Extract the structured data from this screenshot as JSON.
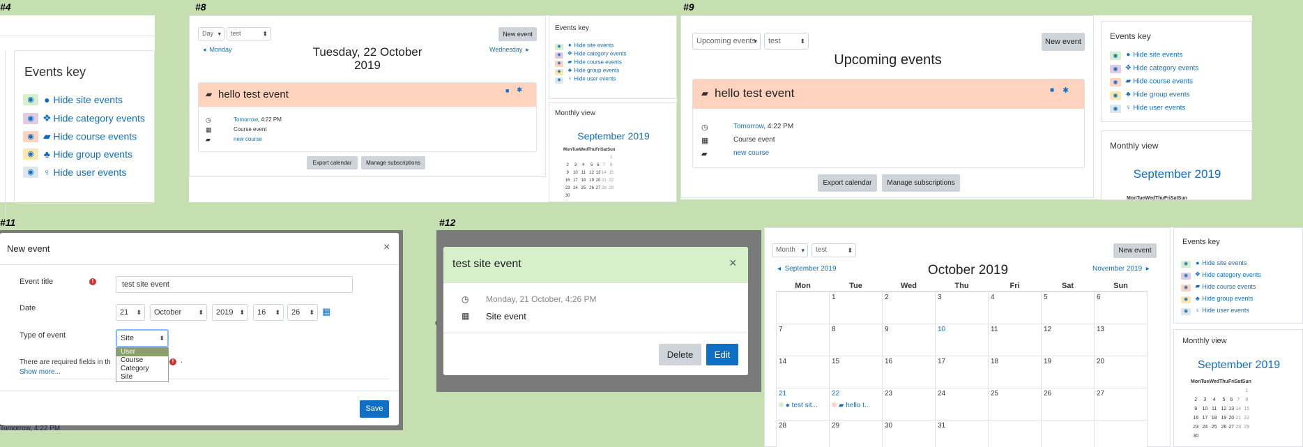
{
  "labels": {
    "p4": "#4",
    "p8": "#8",
    "p9": "#9",
    "p11": "#11",
    "p12": "#12"
  },
  "colors": {
    "site": "#d7f0cc",
    "category": "#e0cbe0",
    "course": "#ffd3bd",
    "group": "#fee7ae",
    "user": "#dce7ec",
    "primary": "#0f6fc5",
    "header": "#ffd3bd"
  },
  "events_key": {
    "title": "Events key",
    "items": [
      {
        "label": "Hide site events",
        "icon": "globe-icon",
        "glyph": "●"
      },
      {
        "label": "Hide category events",
        "icon": "cubes-icon",
        "glyph": "❖"
      },
      {
        "label": "Hide course events",
        "icon": "graduation-cap-icon",
        "glyph": "▰"
      },
      {
        "label": "Hide group events",
        "icon": "users-icon",
        "glyph": "♣"
      },
      {
        "label": "Hide user events",
        "icon": "user-icon",
        "glyph": "♀"
      }
    ]
  },
  "day_view": {
    "view_select": "Day",
    "course_select": "test",
    "new_event": "New event",
    "prev": "Monday",
    "next": "Wednesday",
    "title_line1": "Tuesday, 22 October",
    "title_line2": "2019",
    "event_name": "hello test event",
    "time_link": "Tomorrow",
    "time_rest": ", 4:22 PM",
    "event_type": "Course event",
    "course_link": "new course",
    "export": "Export calendar",
    "manage": "Manage subscriptions"
  },
  "upcoming_view": {
    "view_select": "Upcoming events",
    "course_select": "test",
    "new_event": "New event",
    "title": "Upcoming events",
    "event_name": "hello test event",
    "time_link": "Tomorrow",
    "time_rest": ", 4:22 PM",
    "event_type": "Course event",
    "course_link": "new course",
    "export": "Export calendar",
    "manage": "Manage subscriptions"
  },
  "mini_calendar": {
    "title": "Monthly view",
    "month": "September 2019",
    "days": [
      "Mon",
      "Tue",
      "Wed",
      "Thu",
      "Fri",
      "Sat",
      "Sun"
    ],
    "weeks": [
      [
        "",
        "",
        "",
        "",
        "",
        "",
        "1"
      ],
      [
        "2",
        "3",
        "4",
        "5",
        "6",
        "7",
        "8"
      ],
      [
        "9",
        "10",
        "11",
        "12",
        "13",
        "14",
        "15"
      ],
      [
        "16",
        "17",
        "18",
        "19",
        "20",
        "21",
        "22"
      ],
      [
        "23",
        "24",
        "25",
        "26",
        "27",
        "28",
        "29"
      ],
      [
        "30",
        "",
        "",
        "",
        "",
        "",
        ""
      ]
    ]
  },
  "new_event_modal": {
    "title": "New event",
    "close": "×",
    "event_title_label": "Event title",
    "event_title_value": "test site event",
    "date_label": "Date",
    "day": "21",
    "month": "October",
    "year": "2019",
    "hour": "16",
    "minute": "26",
    "type_label": "Type of event",
    "type_value": "Site",
    "type_options": [
      "User",
      "Course",
      "Category",
      "Site"
    ],
    "required_text": "There are required fields in th",
    "required_tail": ".",
    "show_more": "Show more...",
    "save": "Save",
    "behind_text": "Tomorrow, 4:22 PM",
    "behind_frag": "Co"
  },
  "site_event_modal": {
    "title": "test site event",
    "close": "×",
    "datetime": "Monday, 21 October, 4:26 PM",
    "type": "Site event",
    "delete": "Delete",
    "edit": "Edit"
  },
  "month_view": {
    "view_select": "Month",
    "course_select": "test",
    "new_event": "New event",
    "prev": "September 2019",
    "next": "November 2019",
    "title": "October 2019",
    "days": [
      "Mon",
      "Tue",
      "Wed",
      "Thu",
      "Fri",
      "Sat",
      "Sun"
    ],
    "weeks": [
      [
        "",
        "1",
        "2",
        "3",
        "4",
        "5",
        "6"
      ],
      [
        "7",
        "8",
        "9",
        "10",
        "11",
        "12",
        "13"
      ],
      [
        "14",
        "15",
        "16",
        "17",
        "18",
        "19",
        "20"
      ],
      [
        "21",
        "22",
        "23",
        "24",
        "25",
        "26",
        "27"
      ],
      [
        "28",
        "29",
        "30",
        "31",
        "",
        "",
        ""
      ]
    ],
    "event_site": "test sit...",
    "event_course": "hello t..."
  }
}
